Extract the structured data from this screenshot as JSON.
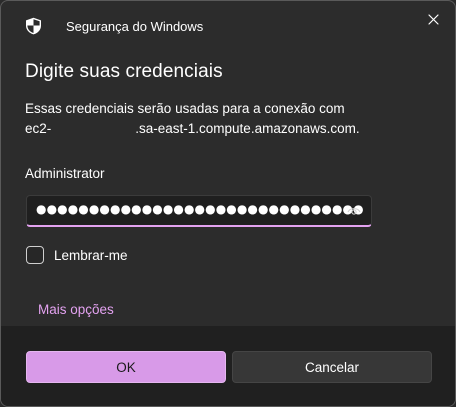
{
  "window": {
    "app_title": "Segurança do Windows",
    "close_icon": "close-icon"
  },
  "dialog": {
    "heading": "Digite suas credenciais",
    "description_line1": "Essas credenciais serão usadas para a conexão com",
    "host_prefix": "ec2-",
    "host_suffix": ".sa-east-1.compute.amazonaws.com.",
    "username": "Administrator",
    "password_masked": "●●●●●●●●●●●●●●●●●●●●●●●●●●●●●●●",
    "password_toggle_icon": "eye-icon",
    "remember_label": "Lembrar-me",
    "remember_checked": false,
    "more_options": "Mais opções"
  },
  "buttons": {
    "ok": "OK",
    "cancel": "Cancelar"
  },
  "colors": {
    "accent": "#d89ae8",
    "background": "#2c2c2c",
    "footer": "#202020"
  }
}
